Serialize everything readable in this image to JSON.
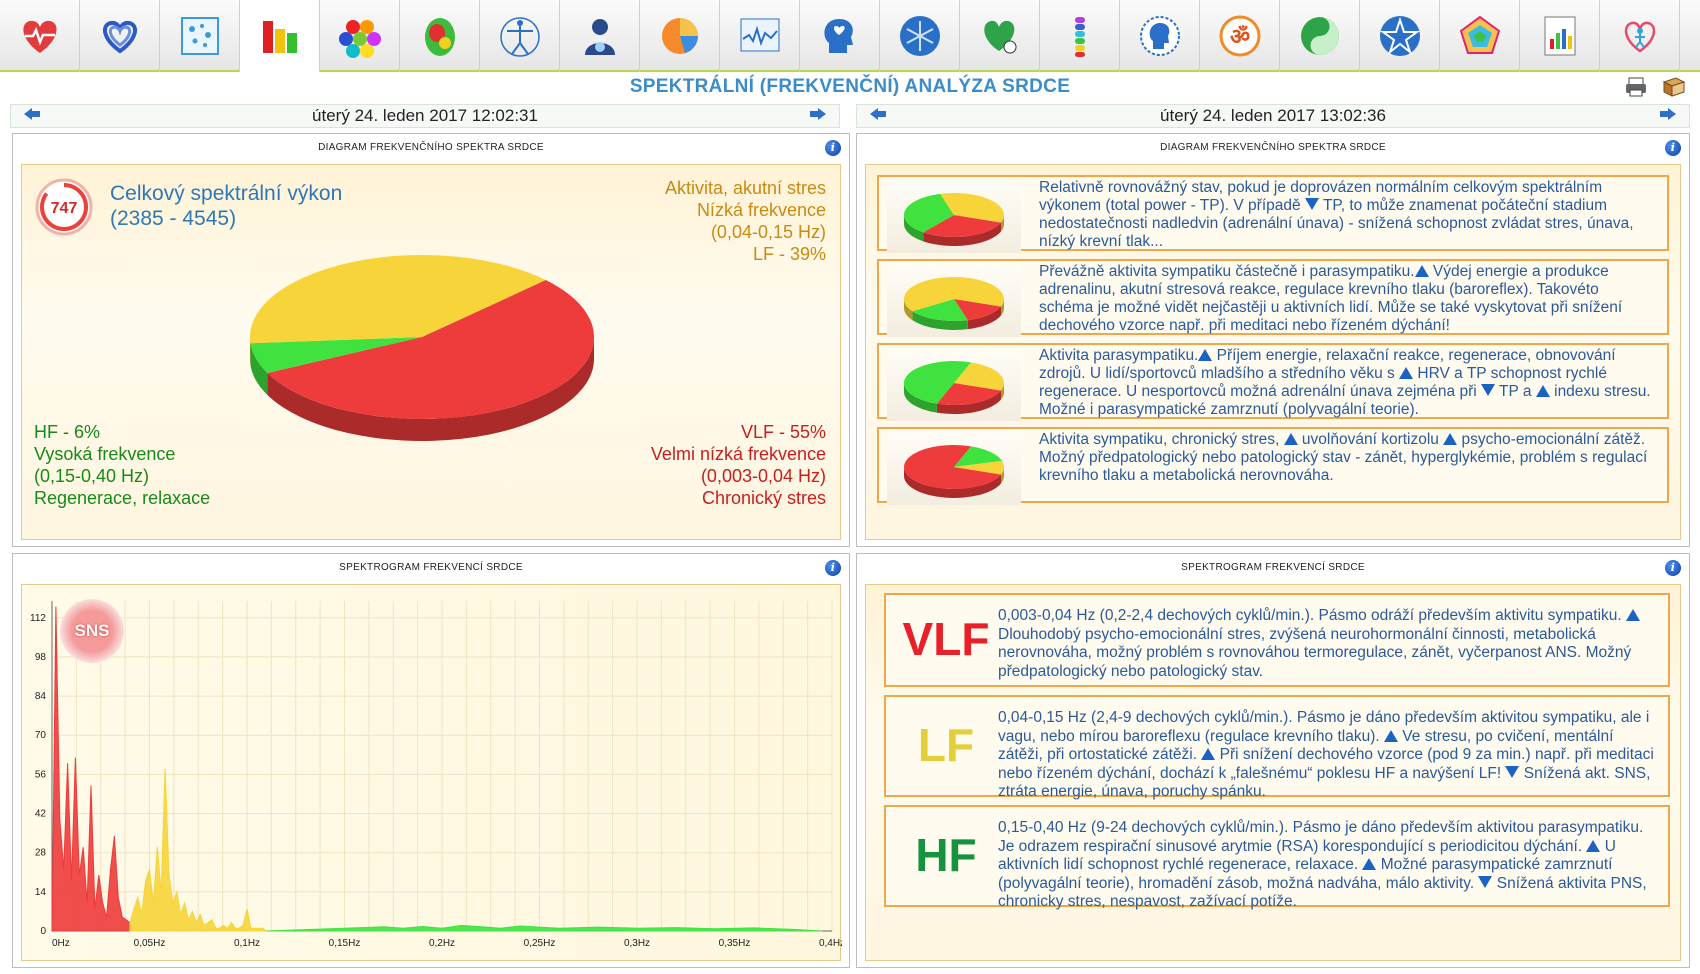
{
  "toolbar": {
    "items": [
      {
        "name": "heart-icon"
      },
      {
        "name": "double-heart-icon"
      },
      {
        "name": "bubbles-icon"
      },
      {
        "name": "bar-chart-icon",
        "active": true
      },
      {
        "name": "hexagons-icon"
      },
      {
        "name": "brain-map-icon"
      },
      {
        "name": "vitruvian-man-icon"
      },
      {
        "name": "person-icon"
      },
      {
        "name": "pie-chart-icon"
      },
      {
        "name": "waveform-icon"
      },
      {
        "name": "head-heart-icon"
      },
      {
        "name": "neuron-icon"
      },
      {
        "name": "heart-ball-icon"
      },
      {
        "name": "chakra-stack-icon"
      },
      {
        "name": "head-circle-icon"
      },
      {
        "name": "om-icon"
      },
      {
        "name": "yin-yang-icon"
      },
      {
        "name": "star-icon"
      },
      {
        "name": "pentagon-chart-icon"
      },
      {
        "name": "report-icon"
      },
      {
        "name": "heart-person-icon"
      }
    ]
  },
  "header": {
    "title": "SPEKTRÁLNÍ (FREKVENČNÍ) ANALÝZA SRDCE"
  },
  "left": {
    "date": "úterý 24. leden 2017 12:02:31",
    "pie_panel": {
      "title": "DIAGRAM FREKVENČNÍHO SPEKTRA SRDCE",
      "total_value": "747",
      "total_label": "Celkový spektrální výkon",
      "total_range": "(2385 - 4545)",
      "lf": {
        "line1": "Aktivita, akutní stres",
        "line2": "Nízká frekvence",
        "line3": "(0,04-0,15 Hz)",
        "line4": "LF - 39%",
        "percent": 39
      },
      "hf": {
        "line1": "HF - 6%",
        "line2": "Vysoká frekvence",
        "line3": "(0,15-0,40 Hz)",
        "line4": "Regenerace, relaxace",
        "percent": 6
      },
      "vlf": {
        "line1": "VLF - 55%",
        "line2": "Velmi nízká frekvence",
        "line3": "(0,003-0,04 Hz)",
        "line4": "Chronický stres",
        "percent": 55
      }
    },
    "spectro_panel": {
      "title": "SPEKTROGRAM FREKVENCÍ SRDCE",
      "badge": "SNS"
    }
  },
  "right": {
    "date": "úterý 24. leden 2017 13:02:36",
    "pie_panel": {
      "title": "DIAGRAM FREKVENČNÍHO SPEKTRA SRDCE",
      "boxes": [
        {
          "pie": [
            30,
            35,
            35
          ],
          "parts": [
            "Relativně rovnovážný stav, pokud je doprovázen normálním celkovým spektrálním výkonem (total power - TP). V případě ",
            "down",
            " TP, to může znamenat počáteční stadium nedostatečnosti nadledvin (adrenální únava) - snížená schopnost zvládat stres, únava, nízký krevní tlak..."
          ]
        },
        {
          "pie": [
            15,
            65,
            20
          ],
          "parts": [
            "Převážně aktivita sympatiku částečně i parasympatiku.",
            "up",
            " Výdej energie a produkce adrenalinu, akutní stresová reakce, regulace krevního tlaku (baroreflex). Takovéto schéma je možné vidět nejčastěji u aktivních lidí. Může se také vyskytovat při snížení dechového vzorce např. při meditaci nebo řízeném dýchání!"
          ]
        },
        {
          "pie": [
            25,
            25,
            50
          ],
          "parts": [
            "Aktivita parasympatiku.",
            "up",
            " Příjem energie, relaxační reakce, regenerace, obnovování zdrojů. U lidí/sportovců mladšího a středního věku s ",
            "up",
            " HRV a TP schopnost rychlé regenerace. U nesportovců možná adrenální únava zejména při ",
            "down",
            " TP a ",
            "up",
            " indexu stresu. Možné i parasympatické zamrznutí (polyvagální teorie)."
          ]
        },
        {
          "pie": [
            75,
            10,
            15
          ],
          "parts": [
            "Aktivita sympatiku, chronický stres, ",
            "up",
            " uvolňování kortizolu ",
            "up",
            " psycho-emocionální zátěž. Možný předpatologický nebo patologický stav - zánět, hyperglykémie, problém s regulací krevního tlaku a metabolická nerovnováha."
          ]
        }
      ]
    },
    "bands_panel": {
      "title": "SPEKTROGRAM FREKVENCÍ SRDCE",
      "bands": [
        {
          "label": "VLF",
          "color": "#e8202a",
          "parts": [
            "0,003-0,04 Hz (0,2-2,4 dechových cyklů/min.). Pásmo odráží především aktivitu sympatiku. ",
            "up",
            " Dlouhodobý psycho-emocionální stres, zvýšená neurohormonální činnosti, metabolická nerovnováha, možný problém s rovnováhou termoregulace, zánět, vyčerpanost ANS. Možný předpatologický nebo patologický stav."
          ]
        },
        {
          "label": "LF",
          "color": "#e2cf3a",
          "parts": [
            "0,04-0,15 Hz (2,4-9 dechových cyklů/min.). Pásmo je dáno především aktivitou sympatiku, ale i vagu, nebo mírou baroreflexu (regulace krevního tlaku). ",
            "up",
            " Ve stresu, po cvičení, mentální zátěži, při ortostatické zátěži. ",
            "up",
            " Při snížení dechového vzorce (pod 9 za min.) např. při meditaci nebo řízeném dýchání, dochází k „falešnému“ poklesu HF a navýšení LF! ",
            "down",
            " Snížená akt. SNS, ztráta energie, únava, poruchy spánku."
          ]
        },
        {
          "label": "HF",
          "color": "#17923f",
          "parts": [
            "0,15-0,40 Hz (9-24 dechových cyklů/min.). Pásmo je dáno především aktivitou parasympatiku. Je odrazem respirační sinusové arytmie (RSA) korespondující s periodicitou dýchání. ",
            "up",
            " U aktivních lidí schopnost rychlé regenerace, relaxace. ",
            "up",
            " Možné parasympatické zamrznutí (polyvagální teorie), hromadění zásob, možná nadváha, málo aktivity. ",
            "down",
            " Snížená aktivita PNS, chronicky stres, nespavost, zažívací potíže."
          ]
        }
      ]
    }
  },
  "colors": {
    "vlf": "#ee3b3b",
    "lf": "#f7d43a",
    "hf": "#3fe23f",
    "accent": "#3b8cc9"
  },
  "chart_data": {
    "type": "area",
    "xlabel": "",
    "ylabel": "",
    "ylim": [
      0,
      118
    ],
    "xlim": [
      0,
      0.4
    ],
    "y_ticks": [
      "0",
      "14",
      "28",
      "42",
      "56",
      "70",
      "84",
      "98",
      "112"
    ],
    "x_ticks": [
      "0Hz",
      "0,05Hz",
      "0,1Hz",
      "0,15Hz",
      "0,2Hz",
      "0,25Hz",
      "0,3Hz",
      "0,35Hz",
      "0,4Hz"
    ],
    "series": [
      {
        "color": "#ee3b3b",
        "x": [
          0,
          0.002,
          0.004,
          0.006,
          0.008,
          0.01,
          0.012,
          0.014,
          0.016,
          0.018,
          0.02,
          0.022,
          0.024,
          0.026,
          0.028,
          0.03,
          0.032,
          0.034,
          0.036,
          0.038,
          0.04
        ],
        "y": [
          0,
          116,
          40,
          22,
          60,
          18,
          62,
          20,
          30,
          10,
          52,
          8,
          20,
          10,
          5,
          22,
          34,
          12,
          5,
          4,
          3
        ]
      },
      {
        "color": "#f7d43a",
        "x": [
          0.04,
          0.042,
          0.044,
          0.046,
          0.048,
          0.05,
          0.052,
          0.054,
          0.056,
          0.058,
          0.06,
          0.062,
          0.064,
          0.066,
          0.068,
          0.07,
          0.072,
          0.074,
          0.076,
          0.078,
          0.08,
          0.082,
          0.084,
          0.086,
          0.088,
          0.09,
          0.092,
          0.094,
          0.096,
          0.098,
          0.1,
          0.102,
          0.104,
          0.106,
          0.108,
          0.11
        ],
        "y": [
          3,
          8,
          12,
          6,
          18,
          22,
          10,
          30,
          14,
          58,
          20,
          10,
          14,
          6,
          10,
          4,
          7,
          3,
          6,
          2,
          3,
          4,
          1,
          1,
          2,
          1,
          3,
          1,
          1,
          2,
          8,
          1,
          1,
          1,
          1,
          0
        ]
      },
      {
        "color": "#3fe23f",
        "x": [
          0.11,
          0.13,
          0.15,
          0.17,
          0.18,
          0.19,
          0.2,
          0.21,
          0.22,
          0.23,
          0.24,
          0.26,
          0.28,
          0.3,
          0.32,
          0.34,
          0.36,
          0.38,
          0.395
        ],
        "y": [
          0,
          0.5,
          1,
          1.5,
          1,
          1.6,
          1,
          2,
          1.5,
          1,
          1.8,
          1,
          1.4,
          1,
          1.2,
          0.8,
          1.1,
          0.6,
          0
        ]
      }
    ]
  }
}
